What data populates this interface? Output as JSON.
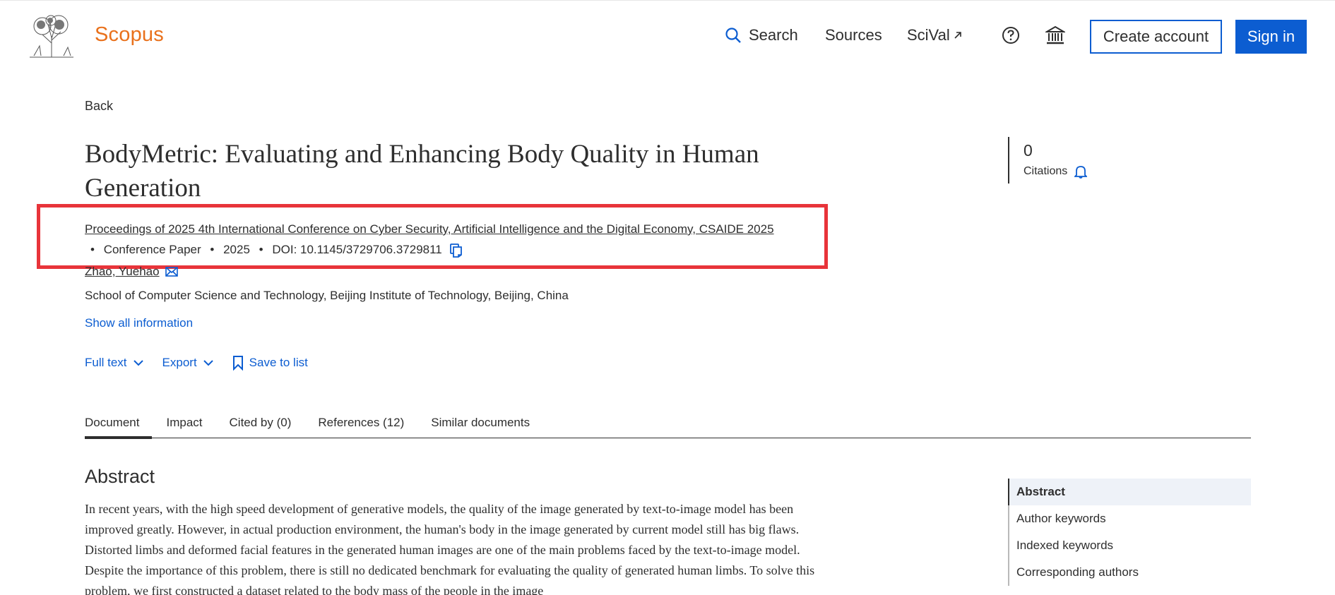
{
  "header": {
    "brand": "Scopus",
    "nav": {
      "search": "Search",
      "sources": "Sources",
      "scival": "SciVal"
    },
    "create_account": "Create account",
    "sign_in": "Sign in"
  },
  "page": {
    "back": "Back",
    "title": "BodyMetric: Evaluating and Enhancing Body Quality in Human Generation",
    "source": {
      "journal": "Proceedings of 2025 4th International Conference on Cyber Security, Artificial Intelligence and the Digital Economy, CSAIDE 2025",
      "doc_type": "Conference Paper",
      "year": "2025",
      "doi": "DOI: 10.1145/3729706.3729811"
    },
    "author": "Zhao, Yuehao",
    "affiliation": "School of Computer Science and Technology, Beijing Institute of Technology, Beijing, China",
    "show_all": "Show all information",
    "actions": {
      "full_text": "Full text",
      "export": "Export",
      "save": "Save to list"
    },
    "tabs": [
      "Document",
      "Impact",
      "Cited by (0)",
      "References (12)",
      "Similar documents"
    ],
    "abstract_heading": "Abstract",
    "abstract": "In recent years, with the high speed development of generative models, the quality of the image generated by text-to-image model has been improved greatly. However, in actual production environment, the human's body in the image generated by current model still has big flaws. Distorted limbs and deformed facial features in the generated human images are one of the main problems faced by the text-to-image model. Despite the importance of this problem, there is still no dedicated benchmark for evaluating the quality of generated human limbs. To solve this problem, we first constructed a dataset related to the body mass of the people in the image"
  },
  "citations": {
    "count": "0",
    "label": "Citations"
  },
  "outline": [
    "Abstract",
    "Author keywords",
    "Indexed keywords",
    "Corresponding authors"
  ],
  "colors": {
    "brand": "#e9711c",
    "link": "#0c5dd1",
    "highlight": "#e8343a"
  }
}
